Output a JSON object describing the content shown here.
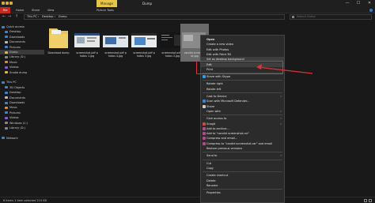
{
  "window": {
    "title": "Dump",
    "manage_tab": "Manage",
    "minimize_icon": "—",
    "maximize_icon": "☐",
    "close_icon": "✕"
  },
  "ribbon": {
    "tabs": [
      "File",
      "Home",
      "Share",
      "View",
      "Picture Tools"
    ]
  },
  "address": {
    "back_icon": "←",
    "forward_icon": "→",
    "up_icon": "↑",
    "crumbs": [
      "This PC",
      "›",
      "Desktop",
      "›",
      "Dump"
    ],
    "search_placeholder": "Search Dump"
  },
  "nav": {
    "items": [
      {
        "label": "Quick access",
        "icon": "star-icon",
        "color": "#3a86d6"
      },
      {
        "label": "Desktop",
        "icon": "desktop-icon",
        "color": "#3a86d6"
      },
      {
        "label": "Downloads",
        "icon": "download-icon",
        "color": "#3a86d6"
      },
      {
        "label": "Documents",
        "icon": "document-icon",
        "color": "#bbbbbb"
      },
      {
        "label": "Pictures",
        "icon": "picture-icon",
        "color": "#3a86d6"
      },
      {
        "label": "Dump",
        "icon": "folder-icon",
        "color": "#e0b84a"
      },
      {
        "label": "Library (D:)",
        "icon": "drive-icon",
        "color": "#888888"
      },
      {
        "label": "Music",
        "icon": "music-icon",
        "color": "#e08a3a"
      },
      {
        "label": "Videos",
        "icon": "video-icon",
        "color": "#8a5ad6"
      },
      {
        "label": "Snabb dump",
        "icon": "folder-icon",
        "color": "#e0b84a"
      },
      {
        "label": "",
        "icon": "",
        "color": ""
      },
      {
        "label": "This PC",
        "icon": "pc-icon",
        "color": "#3a86d6"
      },
      {
        "label": "3D Objects",
        "icon": "cube-icon",
        "color": "#3a86d6"
      },
      {
        "label": "Desktop",
        "icon": "desktop-icon",
        "color": "#3a86d6"
      },
      {
        "label": "Documents",
        "icon": "document-icon",
        "color": "#bbbbbb"
      },
      {
        "label": "Downloads",
        "icon": "download-icon",
        "color": "#3a86d6"
      },
      {
        "label": "Music",
        "icon": "music-icon",
        "color": "#e08a3a"
      },
      {
        "label": "Pictures",
        "icon": "picture-icon",
        "color": "#3a86d6"
      },
      {
        "label": "Videos",
        "icon": "video-icon",
        "color": "#8a5ad6"
      },
      {
        "label": "Windows (C:)",
        "icon": "drive-icon",
        "color": "#888888"
      },
      {
        "label": "Library (D:)",
        "icon": "drive-icon",
        "color": "#888888"
      },
      {
        "label": "",
        "icon": "",
        "color": ""
      },
      {
        "label": "Network",
        "icon": "network-icon",
        "color": "#3a86d6"
      }
    ],
    "selected_index": 5
  },
  "files": [
    {
      "label": "Download dump",
      "kind": "folder"
    },
    {
      "label": "screenshot pdf p hotos 1.jpg",
      "kind": "image"
    },
    {
      "label": "screenshot pdf p hotos 4.jpg",
      "kind": "image"
    },
    {
      "label": "screenshot pdf p hotos 3.jpg",
      "kind": "image"
    },
    {
      "label": "screenshot pdf p hotos 2.jpg",
      "kind": "image"
    },
    {
      "label": "candid screensh ot.jpg",
      "kind": "image",
      "selected": true
    }
  ],
  "status": {
    "text": "6 items   1 item selected   215 KB"
  },
  "context_menu": {
    "items": [
      {
        "type": "item",
        "label": "Open",
        "bold": true
      },
      {
        "type": "item",
        "label": "Create a new video"
      },
      {
        "type": "item",
        "label": "Edit with Photos"
      },
      {
        "type": "item",
        "label": "Edit with Paint 3D"
      },
      {
        "type": "item",
        "label": "Set as desktop background",
        "hl": true
      },
      {
        "type": "item",
        "label": "Edit",
        "hl": true
      },
      {
        "type": "item",
        "label": "Print"
      },
      {
        "type": "sep"
      },
      {
        "type": "item",
        "label": "Share with Skype",
        "icon": "skype-icon",
        "color": "#2aa0e8"
      },
      {
        "type": "sep"
      },
      {
        "type": "item",
        "label": "Rotate right"
      },
      {
        "type": "item",
        "label": "Rotate left"
      },
      {
        "type": "sep"
      },
      {
        "type": "item",
        "label": "Cast to Device",
        "arrow": true
      },
      {
        "type": "item",
        "label": "Scan with Microsoft Defender...",
        "icon": "shield-icon",
        "color": "#3a86d6"
      },
      {
        "type": "item",
        "label": "Share",
        "icon": "share-icon",
        "color": "#cccccc"
      },
      {
        "type": "item",
        "label": "Open with",
        "arrow": true
      },
      {
        "type": "sep"
      },
      {
        "type": "item",
        "label": "Give access to",
        "arrow": true
      },
      {
        "type": "item",
        "label": "Snagit",
        "icon": "snagit-icon",
        "color": "#d64a3a",
        "arrow": true
      },
      {
        "type": "item",
        "label": "Add to archive...",
        "icon": "archive-icon",
        "color": "#b04a8a"
      },
      {
        "type": "item",
        "label": "Add to \"candid screenshot.rar\"",
        "icon": "archive-icon",
        "color": "#b04a8a"
      },
      {
        "type": "item",
        "label": "Compress and email...",
        "icon": "archive-icon",
        "color": "#b04a8a"
      },
      {
        "type": "item",
        "label": "Compress to \"candid screenshot.rar\" and email",
        "icon": "archive-icon",
        "color": "#b04a8a"
      },
      {
        "type": "item",
        "label": "Restore previous versions"
      },
      {
        "type": "sep"
      },
      {
        "type": "item",
        "label": "Send to",
        "arrow": true
      },
      {
        "type": "sep"
      },
      {
        "type": "item",
        "label": "Cut"
      },
      {
        "type": "item",
        "label": "Copy"
      },
      {
        "type": "sep"
      },
      {
        "type": "item",
        "label": "Create shortcut"
      },
      {
        "type": "item",
        "label": "Delete"
      },
      {
        "type": "item",
        "label": "Rename"
      },
      {
        "type": "sep"
      },
      {
        "type": "item",
        "label": "Properties"
      }
    ]
  },
  "annotation": {
    "color": "#e0303a"
  }
}
